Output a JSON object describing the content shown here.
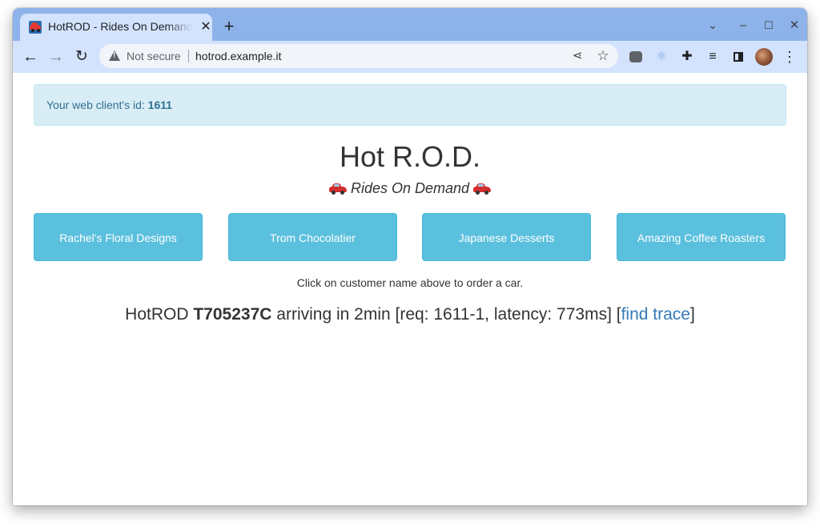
{
  "browser": {
    "tab": {
      "title": "HotROD - Rides On Demand",
      "close_icon": "close-icon"
    },
    "new_tab_icon": "plus-icon",
    "window_controls": {
      "dropdown": "⌄",
      "minimize": "–",
      "maximize": "☐",
      "close": "✕"
    },
    "toolbar": {
      "back_icon": "arrow-left-icon",
      "forward_icon": "arrow-right-icon",
      "reload_icon": "reload-icon",
      "security_label": "Not secure",
      "url": "hotrod.example.it",
      "share_icon": "share-icon",
      "bookmark_icon": "star-icon",
      "extensions": [
        "line-extension-icon",
        "react-devtools-icon",
        "puzzle-icon",
        "media-control-icon",
        "side-panel-icon"
      ],
      "profile_icon": "avatar",
      "menu_icon": "kebab-menu-icon"
    }
  },
  "page": {
    "alert": {
      "prefix": "Your web client's id: ",
      "client_id": "1611"
    },
    "title": "Hot R.O.D.",
    "subtitle": "Rides On Demand",
    "customers": [
      "Rachel's Floral Designs",
      "Trom Chocolatier",
      "Japanese Desserts",
      "Amazing Coffee Roasters"
    ],
    "hint": "Click on customer name above to order a car.",
    "status": {
      "prefix": "HotROD ",
      "car_id": "T705237C",
      "middle": " arriving in 2min [req: 1611-1, latency: 773ms] [",
      "link": "find trace",
      "suffix": "]"
    }
  },
  "colors": {
    "tabstrip": "#8eb2ea",
    "toolbar": "#d3e3fd",
    "alert_bg": "#d9edf7",
    "alert_text": "#31708f",
    "customer_button": "#5bc0de",
    "link": "#337ab7"
  }
}
